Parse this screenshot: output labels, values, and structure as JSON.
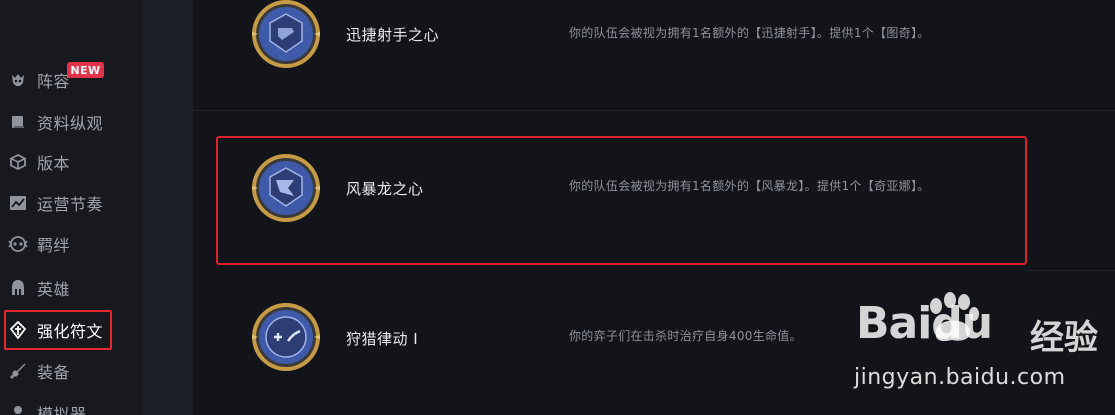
{
  "sidebar": {
    "items": [
      {
        "label": "阵容",
        "icon": "skull-icon",
        "badge": "NEW"
      },
      {
        "label": "资料纵观",
        "icon": "book-icon"
      },
      {
        "label": "版本",
        "icon": "cube-icon"
      },
      {
        "label": "运营节奏",
        "icon": "chart-icon"
      },
      {
        "label": "羁绊",
        "icon": "mask-icon"
      },
      {
        "label": "英雄",
        "icon": "helmet-icon"
      },
      {
        "label": "强化符文",
        "icon": "rune-icon",
        "active": true
      },
      {
        "label": "装备",
        "icon": "sword-icon"
      },
      {
        "label": "模拟器",
        "icon": "person-icon"
      }
    ]
  },
  "augments": [
    {
      "name": "迅捷射手之心",
      "description": "你的队伍会被视为拥有1名额外的【迅捷射手】。提供1个【图奇】。",
      "icon": "swiftshot-medal-icon"
    },
    {
      "name": "风暴龙之心",
      "description": "你的队伍会被视为拥有1名额外的【风暴龙】。提供1个【奇亚娜】。",
      "icon": "stormdragon-medal-icon",
      "highlighted": true
    },
    {
      "name": "狩猎律动 I",
      "description": "你的弈子们在击杀时治疗自身400生命值。",
      "icon": "hunt-medal-icon"
    }
  ],
  "watermark": {
    "logo": "Baidu",
    "logo_cn": "经验",
    "url": "jingyan.baidu.com"
  },
  "colors": {
    "background": "#121419",
    "sidebar": "#17191f",
    "highlight_border": "#d8232c",
    "badge": "#e3334b"
  }
}
